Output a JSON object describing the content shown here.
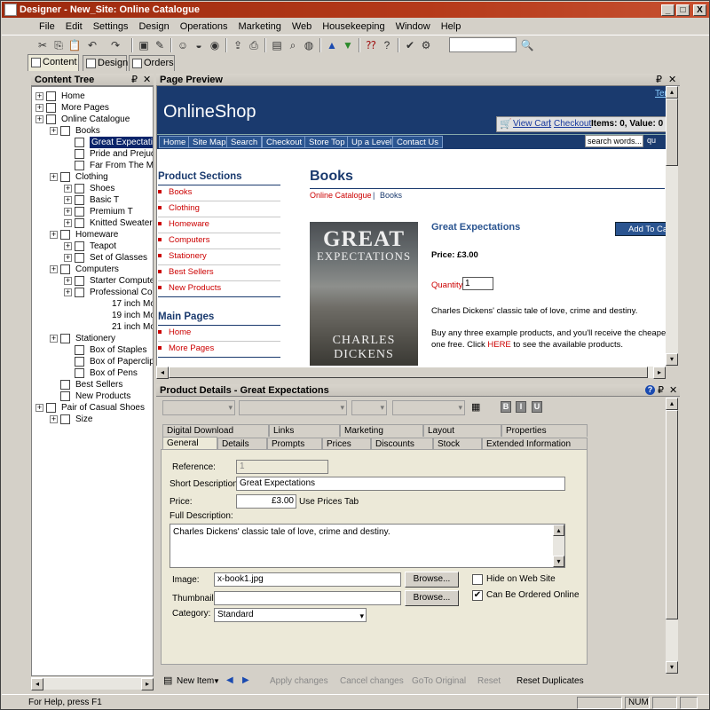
{
  "window": {
    "title": "Designer - New_Site: Online Catalogue",
    "min": "_",
    "max": "□",
    "close": "X"
  },
  "menu": [
    "File",
    "Edit",
    "Settings",
    "Design",
    "Operations",
    "Marketing",
    "Web",
    "Housekeeping",
    "Window",
    "Help"
  ],
  "view_tabs": [
    "Content",
    "Design",
    "Orders"
  ],
  "content_tree": {
    "title": "Content Tree",
    "pin": "₽",
    "close": "✕",
    "nodes": [
      "Home",
      "More Pages",
      "Online Catalogue",
      "Books",
      "Great Expectatio",
      "Pride and Prejudi",
      "Far From The Ma",
      "Clothing",
      "Shoes",
      "Basic T",
      "Premium T",
      "Knitted Sweater",
      "Homeware",
      "Teapot",
      "Set of Glasses",
      "Computers",
      "Starter Computer",
      "Professional Com",
      "17 inch Monitor",
      "19 inch Monitor",
      "21 inch Monitor",
      "Stationery",
      "Box of Staples",
      "Box of Paperclips",
      "Box of Pens",
      "Best Sellers",
      "New Products",
      "Pair of Casual Shoes",
      "Size"
    ]
  },
  "page_preview": {
    "title": "Page Preview",
    "pin": "₽",
    "close": "✕",
    "top_link": "Ter",
    "shop_name": "OnlineShop",
    "view_cart": "View Cart",
    "checkout_link": "Checkout",
    "cart_sep": "|",
    "cart_summary": "Items: 0, Value: 0",
    "nav": [
      "Home",
      "Site Map",
      "Search",
      "Checkout",
      "Store Top",
      "Up a Level",
      "Contact Us"
    ],
    "search_placeholder": "search words...",
    "search_btn": "qu",
    "product_sections_heading": "Product Sections",
    "product_sections": [
      "Books",
      "Clothing",
      "Homeware",
      "Computers",
      "Stationery",
      "Best Sellers",
      "New Products"
    ],
    "main_pages_heading": "Main Pages",
    "main_pages": [
      "Home",
      "More Pages"
    ],
    "page_heading": "Books",
    "breadcrumb_1": "Online Catalogue",
    "breadcrumb_sep": "|",
    "breadcrumb_2": "Books",
    "cover_title_1": "GREAT",
    "cover_title_2": "EXPECTATIONS",
    "cover_author_1": "CHARLES",
    "cover_author_2": "DICKENS",
    "product_title": "Great Expectations",
    "add_to_cart": "Add To Car",
    "price": "Price: £3.00",
    "quantity_label": "Quantity",
    "quantity_value": "1",
    "blurb": "Charles Dickens' classic tale of love, crime and destiny.",
    "promo_1": "Buy any three example products, and you'll receive the cheapest",
    "promo_2a": "one free. Click ",
    "promo_link": "HERE",
    "promo_2b": " to see the available products."
  },
  "product_details": {
    "title": "Product Details - Great Expectations",
    "help": "?",
    "pin": "₽",
    "close": "✕",
    "fmt_b": "B",
    "fmt_i": "I",
    "fmt_u": "U",
    "tabs_row1": [
      "Digital Download",
      "Links",
      "Marketing",
      "Layout",
      "Properties"
    ],
    "tabs_row2": [
      "General",
      "Details",
      "Prompts",
      "Prices",
      "Discounts",
      "Stock",
      "Extended Information"
    ],
    "reference_label": "Reference:",
    "reference_value": "1",
    "short_desc_label": "Short Description:",
    "short_desc_value": "Great Expectations",
    "price_label": "Price:",
    "price_value": "£3.00",
    "use_prices_tab": "Use Prices Tab",
    "full_desc_label": "Full Description:",
    "full_desc_value": "Charles Dickens' classic tale of love, crime and destiny.",
    "image_label": "Image:",
    "image_value": "x-book1.jpg",
    "thumbnail_label": "Thumbnail:",
    "thumbnail_value": "",
    "browse": "Browse...",
    "hide_on_web": "Hide on Web Site",
    "hide_checked": false,
    "can_be_ordered": "Can Be Ordered Online",
    "can_be_ordered_checked": true,
    "category_label": "Category:",
    "category_value": "Standard",
    "bottom": {
      "new_item": "New Item",
      "apply": "Apply changes",
      "cancel": "Cancel changes",
      "goto": "GoTo Original",
      "reset": "Reset",
      "reset_dup": "Reset Duplicates"
    }
  },
  "status": {
    "help": "For Help, press F1",
    "num": "NUM"
  },
  "colors": {
    "title_bar": "#9c2a0e",
    "shop_blue": "#1a3a6e",
    "link_red": "#cc0000",
    "selection": "#0a246a"
  }
}
